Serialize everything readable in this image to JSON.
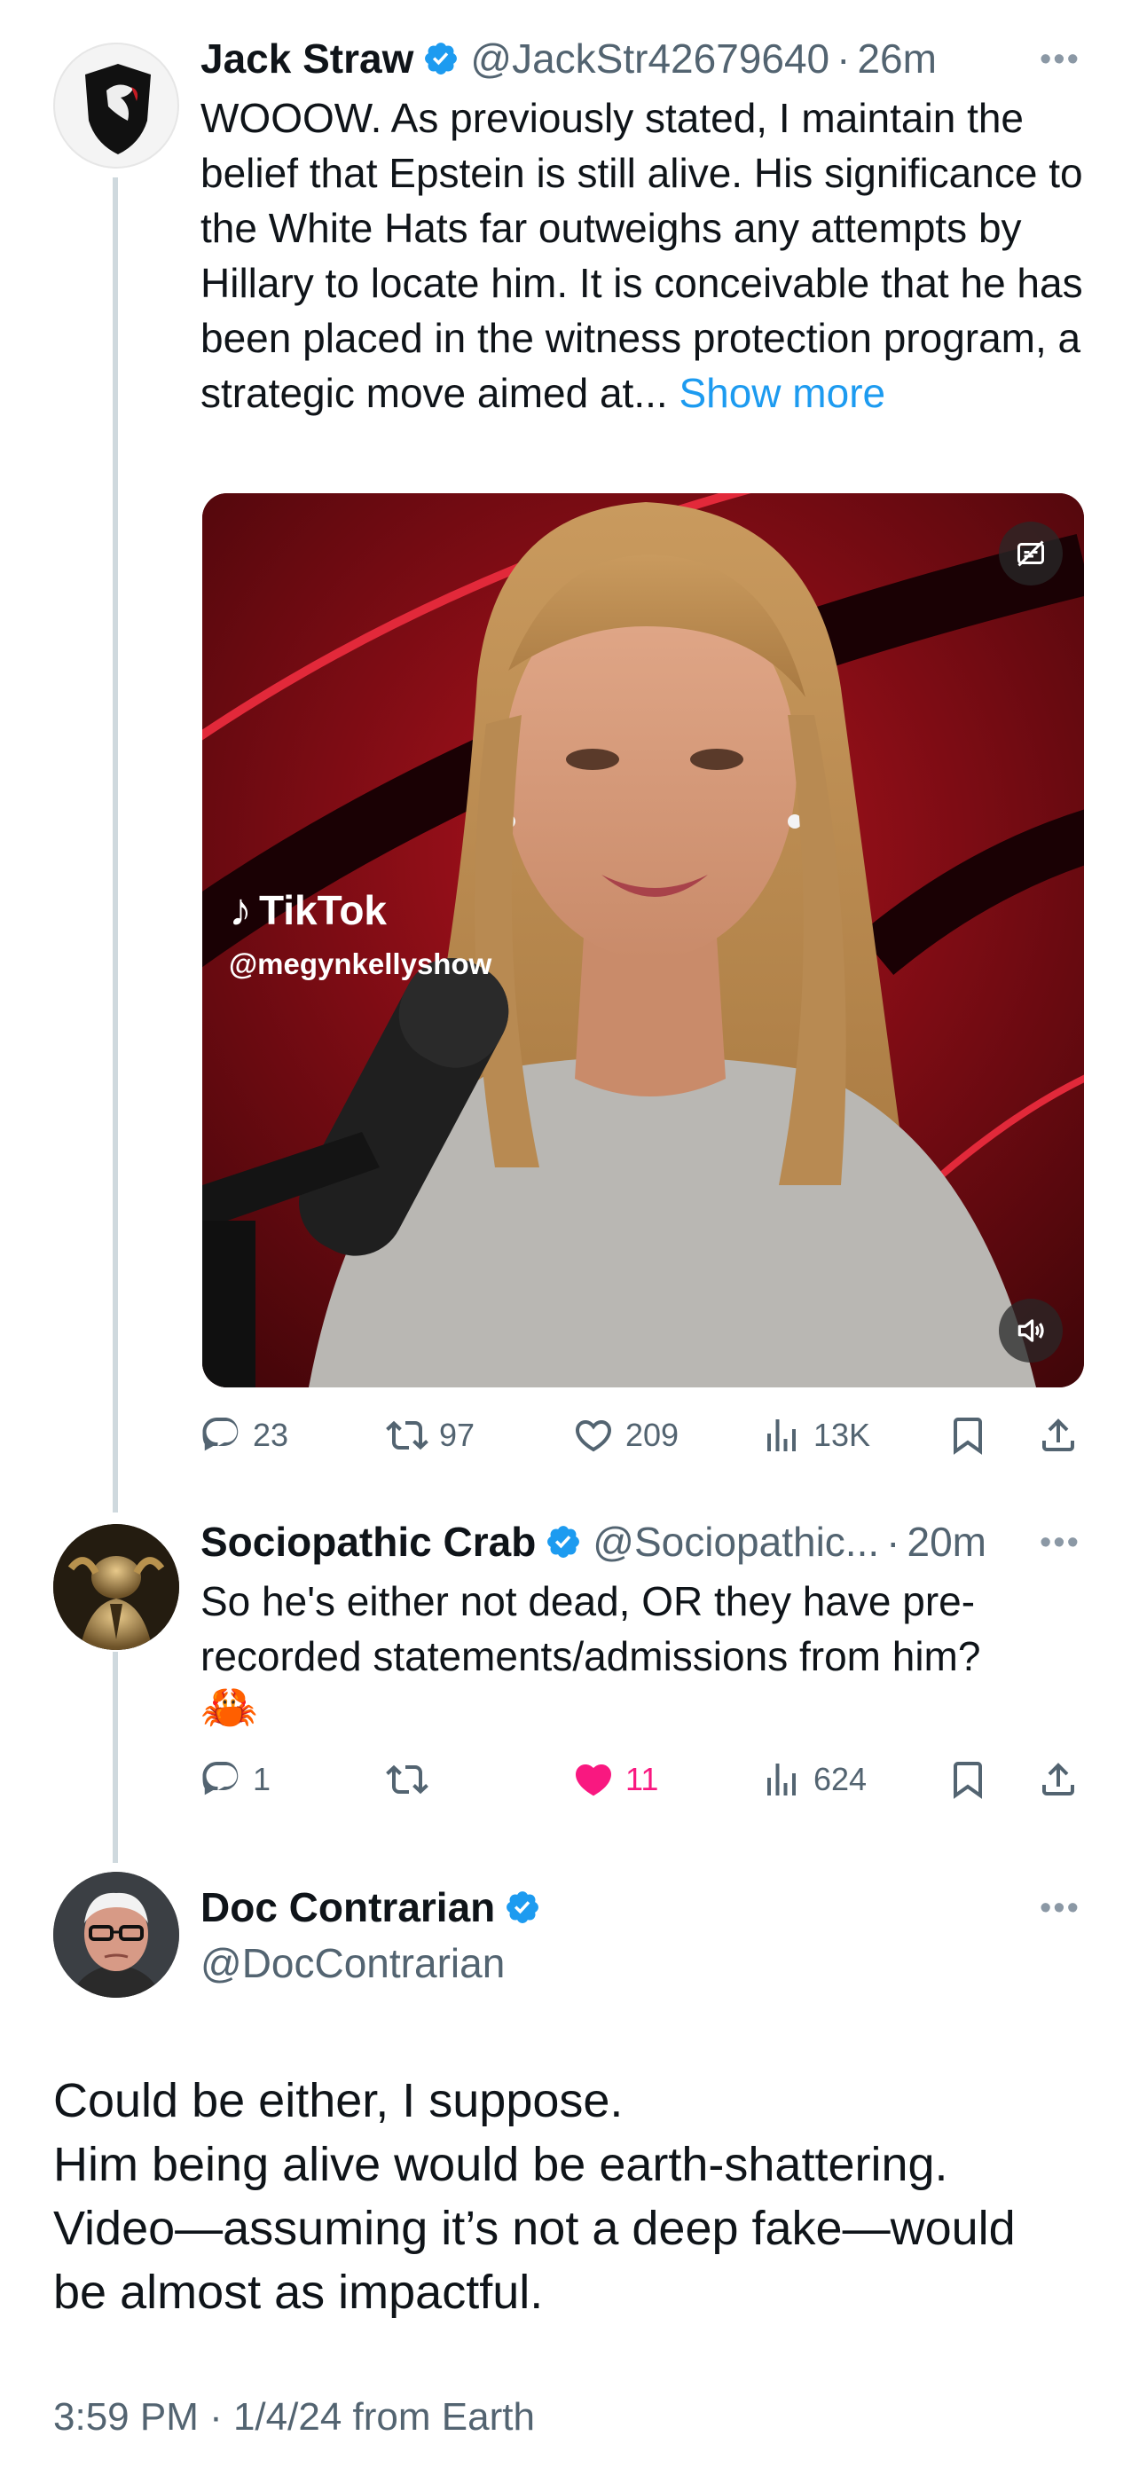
{
  "tweets": [
    {
      "name": "Jack Straw",
      "handle": "@JackStr42679640",
      "time": "26m",
      "text": "WOOOW. As previously stated, I maintain the belief that Epstein is still alive. His significance to the White Hats far outweighs any attempts by Hillary to locate him. It is conceivable that he has been placed in the witness protection program, a strategic move aimed at...",
      "show_more": "Show more",
      "media": {
        "brand": "TikTok",
        "account": "@megynkellyshow"
      },
      "stats": {
        "replies": "23",
        "reposts": "97",
        "likes": "209",
        "views": "13K"
      }
    },
    {
      "name": "Sociopathic Crab",
      "handle": "@Sociopathic...",
      "time": "20m",
      "text": "So he's either not dead, OR they have pre-recorded statements/admissions from him?",
      "emoji": "🦀",
      "stats": {
        "replies": "1",
        "reposts": "",
        "likes": "11",
        "views": "624"
      }
    }
  ],
  "main_tweet": {
    "name": "Doc Contrarian",
    "handle": "@DocContrarian",
    "lines": [
      "Could be either, I suppose.",
      "Him being alive would be earth-shattering.",
      "Video—assuming it’s not a deep fake—would",
      "be almost as impactful."
    ],
    "meta": "3:59 PM · 1/4/24 from Earth"
  },
  "separator": "·",
  "colors": {
    "link": "#1d9bf0",
    "like_active": "#f91880",
    "muted": "#536471",
    "thread_line": "#cfd9de",
    "verified": "#1d9bf0"
  }
}
